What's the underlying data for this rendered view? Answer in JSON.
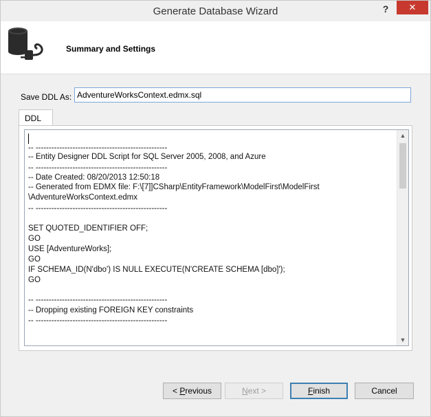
{
  "window": {
    "title": "Generate Database Wizard",
    "help_glyph": "?",
    "close_glyph": "✕"
  },
  "header": {
    "title": "Summary and Settings"
  },
  "save_ddl": {
    "label": "Save DDL As:",
    "value": "AdventureWorksContext.edmx.sql"
  },
  "tabs": [
    {
      "label": "DDL"
    }
  ],
  "ddl_lines": [
    "-- --------------------------------------------------",
    "-- Entity Designer DDL Script for SQL Server 2005, 2008, and Azure",
    "-- --------------------------------------------------",
    "-- Date Created: 08/20/2013 12:50:18",
    "-- Generated from EDMX file: F:\\[7]]CSharp\\EntityFramework\\ModelFirst\\ModelFirst",
    "\\AdventureWorksContext.edmx",
    "-- --------------------------------------------------",
    "",
    "SET QUOTED_IDENTIFIER OFF;",
    "GO",
    "USE [AdventureWorks];",
    "GO",
    "IF SCHEMA_ID(N'dbo') IS NULL EXECUTE(N'CREATE SCHEMA [dbo]');",
    "GO",
    "",
    "-- --------------------------------------------------",
    "-- Dropping existing FOREIGN KEY constraints",
    "-- --------------------------------------------------"
  ],
  "scrollbar": {
    "up_glyph": "▲",
    "down_glyph": "▼"
  },
  "buttons": {
    "previous_prefix": "< ",
    "previous_mnemonic": "P",
    "previous_rest": "revious",
    "next_mnemonic": "N",
    "next_rest": "ext >",
    "finish_mnemonic": "F",
    "finish_rest": "inish",
    "cancel": "Cancel"
  }
}
